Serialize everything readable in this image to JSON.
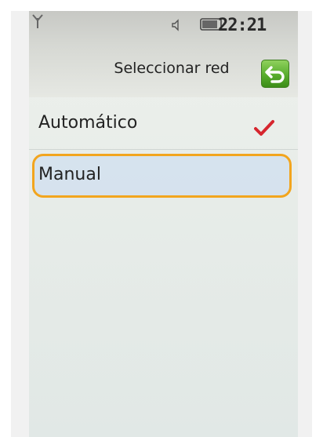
{
  "status": {
    "time": "22:21",
    "signal_icon": "antenna-signal-icon",
    "volume_icon": "speaker-icon",
    "battery_icon": "battery-icon"
  },
  "header": {
    "title": "Seleccionar red",
    "back_icon": "back-arrow-icon",
    "accent_color": "#58ad2d"
  },
  "list": {
    "items": [
      {
        "label": "Automático",
        "selected": true,
        "check_color": "#d6262e"
      },
      {
        "label": "Manual",
        "highlighted": true,
        "highlight_color": "#f2a51e"
      }
    ]
  }
}
